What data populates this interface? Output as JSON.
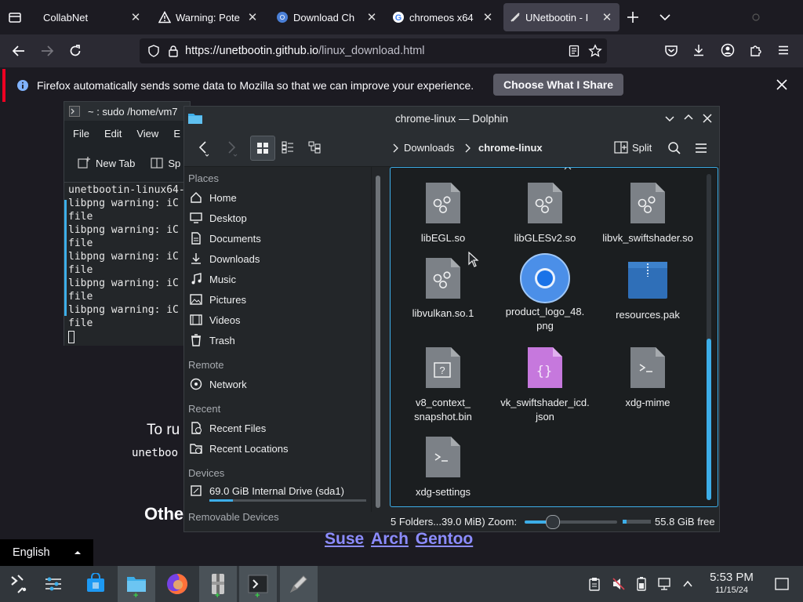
{
  "browser": {
    "tabs": [
      {
        "title": "CollabNet"
      },
      {
        "title": "Warning: Pote"
      },
      {
        "title": "Download Ch"
      },
      {
        "title": "chromeos x64"
      },
      {
        "title": "UNetbootin - I"
      }
    ],
    "url_domain": "https://unetbootin.github.io",
    "url_path": "/linux_download.html",
    "notification": {
      "text": "Firefox automatically sends some data to Mozilla so that we can improve your experience.",
      "button": "Choose What I Share"
    }
  },
  "webpage": {
    "run_text": "To ru",
    "code_text": "unetboo",
    "other_text": "Othe",
    "links": [
      "Suse",
      "Arch",
      "Gentoo"
    ],
    "language": "English"
  },
  "konsole": {
    "title": "~ : sudo /home/vm7",
    "menu": [
      "File",
      "Edit",
      "View",
      "E"
    ],
    "new_tab": "New Tab",
    "split": "Sp",
    "lines": [
      "unetbootin-linux64-",
      "libpng warning: iC",
      "file",
      "libpng warning: iC",
      "file",
      "libpng warning: iC",
      "file",
      "libpng warning: iC",
      "file",
      "libpng warning: iC",
      "file"
    ]
  },
  "dolphin": {
    "title": "chrome-linux — Dolphin",
    "breadcrumb": [
      "Downloads",
      "chrome-linux"
    ],
    "split_label": "Split",
    "places": {
      "header_places": "Places",
      "places": [
        "Home",
        "Desktop",
        "Documents",
        "Downloads",
        "Music",
        "Pictures",
        "Videos",
        "Trash"
      ],
      "header_remote": "Remote",
      "remote": [
        "Network"
      ],
      "header_recent": "Recent",
      "recent": [
        "Recent Files",
        "Recent Locations"
      ],
      "header_devices": "Devices",
      "drive": "69.0 GiB Internal Drive (sda1)",
      "drive_usage_fraction": 0.15,
      "header_removable": "Removable Devices"
    },
    "files": [
      {
        "name": "libEGL.so",
        "icon": "shared-library-icon"
      },
      {
        "name": "libGLESv2.so",
        "icon": "shared-library-icon"
      },
      {
        "name": "libvk_swiftshader.so",
        "icon": "shared-library-icon"
      },
      {
        "name": "libvulkan.so.1",
        "icon": "shared-library-icon"
      },
      {
        "name": "product_logo_48.\npng",
        "icon": "chrome-logo-icon"
      },
      {
        "name": "resources.pak",
        "icon": "archive-icon"
      },
      {
        "name": "v8_context_\nsnapshot.bin",
        "icon": "binary-file-icon"
      },
      {
        "name": "vk_swiftshader_icd.\njson",
        "icon": "json-file-icon"
      },
      {
        "name": "xdg-mime",
        "icon": "script-icon"
      },
      {
        "name": "xdg-settings",
        "icon": "script-icon"
      }
    ],
    "status": "5 Folders...39.0 MiB) Zoom:",
    "free_space": "55.8 GiB free",
    "zoom_fraction": 0.3
  },
  "taskbar": {
    "time": "5:53 PM",
    "date": "11/15/24"
  },
  "colors": {
    "accent": "#3daee9",
    "notif_stripe": "#e02",
    "link": "#8c8cff"
  }
}
